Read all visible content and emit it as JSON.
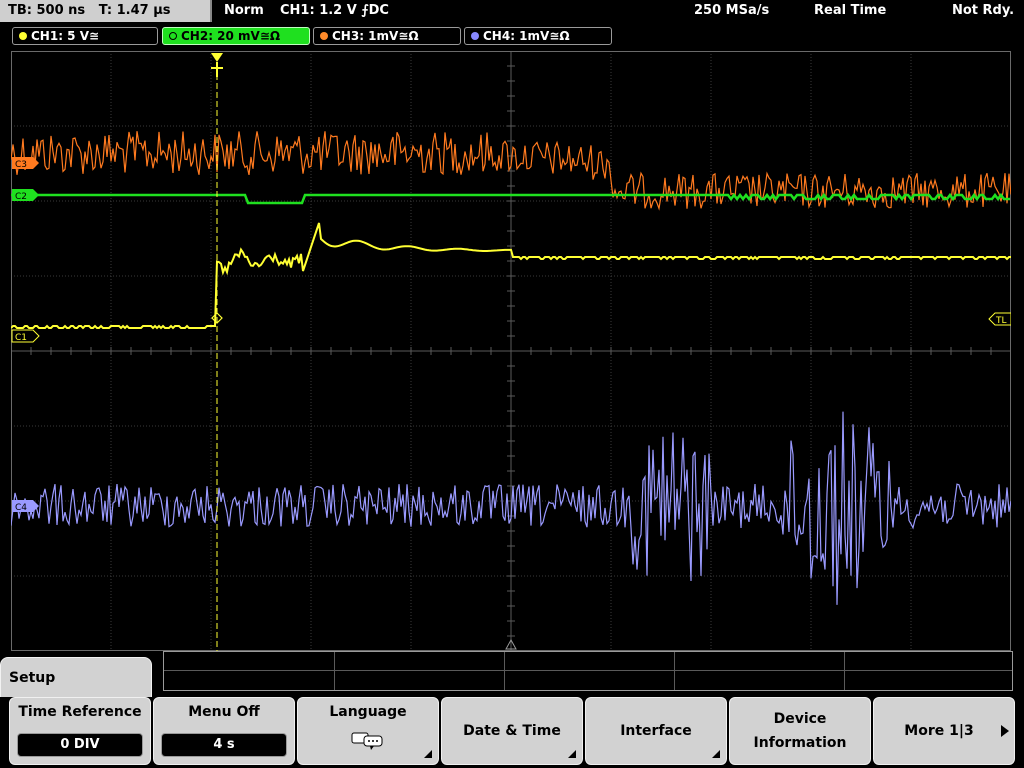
{
  "status": {
    "timebase": "TB: 500 ns",
    "trigger_time": "T: 1.47 µs",
    "mode": "Norm",
    "trigger": "CH1: 1.2 V ⨍DC",
    "sample_rate": "250 MSa/s",
    "acq": "Real Time",
    "state": "Not Rdy."
  },
  "channels": [
    {
      "label": "CH1: 5 V≅",
      "color": "#ffff33"
    },
    {
      "label": "CH2: 20 mV≅Ω",
      "color": "#1fe01f"
    },
    {
      "label": "CH3: 1mV≅Ω",
      "color": "#ff8a2a"
    },
    {
      "label": "CH4: 1mV≅Ω",
      "color": "#8888ff"
    }
  ],
  "markers": {
    "ch3": "C3",
    "ch2": "C2",
    "ch1": "C1",
    "ch4": "C4",
    "trigger_level": "TL",
    "trigger_pos": "T"
  },
  "menu": {
    "title": "Setup",
    "softkeys": [
      {
        "label": "Time Reference",
        "value": "0 DIV"
      },
      {
        "label": "Menu Off",
        "value": "4 s"
      },
      {
        "label": "Language",
        "icon": "language-icon"
      },
      {
        "label": "Date & Time"
      },
      {
        "label": "Interface"
      },
      {
        "label_line1": "Device",
        "label_line2": "Information"
      },
      {
        "label": "More 1|3"
      }
    ]
  }
}
